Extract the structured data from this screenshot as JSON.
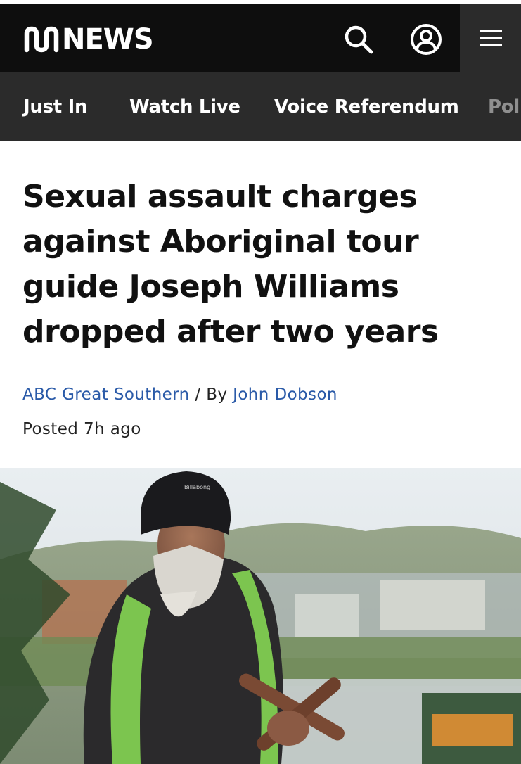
{
  "header": {
    "logo_text": "NEWS",
    "logo_mark_icon": "abc-lissajous-logo-icon",
    "search_icon": "search-icon",
    "account_icon": "account-icon",
    "menu_icon": "hamburger-menu-icon",
    "background": "#0e0e0e"
  },
  "subnav": {
    "items": [
      {
        "label": "Just In"
      },
      {
        "label": "Watch Live"
      },
      {
        "label": "Voice Referendum"
      },
      {
        "label": "Poli"
      }
    ],
    "background": "#2b2b2b"
  },
  "article": {
    "headline": "Sexual assault charges against Aboriginal tour guide Joseph Williams dropped after two years",
    "source": "ABC Great Southern",
    "separator": "/ By",
    "author": "John Dobson",
    "posted": "Posted 7h ago",
    "link_color": "#2a5aa8",
    "hero_image": {
      "description_icon": "photo-of-man-holding-clapsticks",
      "beanie_text": "Billabong"
    }
  }
}
